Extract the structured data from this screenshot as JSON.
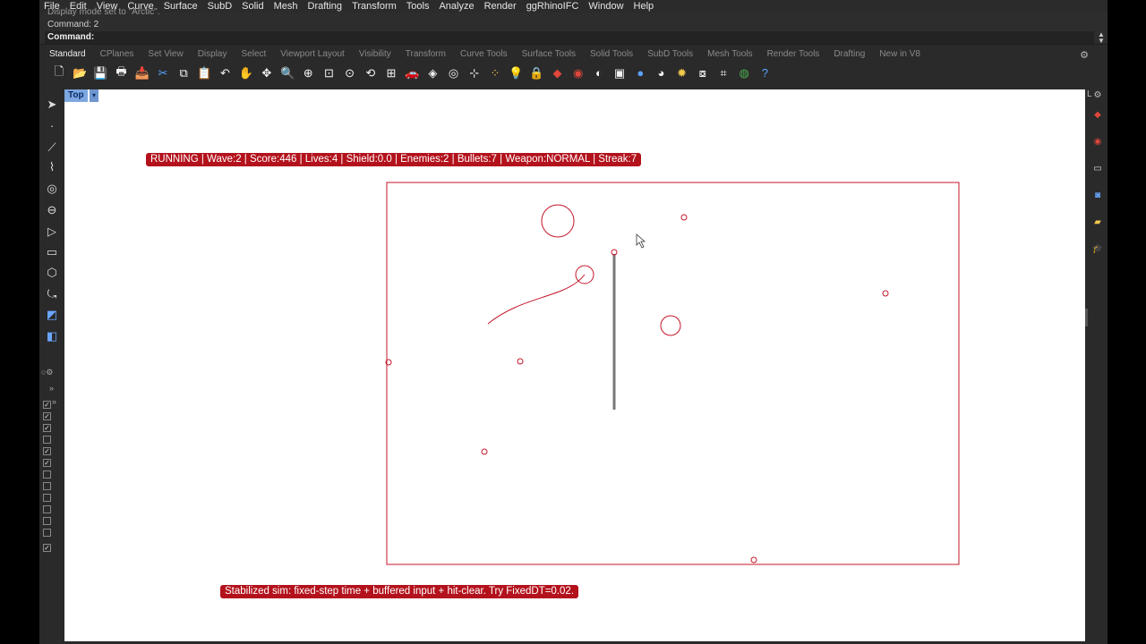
{
  "menu": [
    "File",
    "Edit",
    "View",
    "Curve",
    "Surface",
    "SubD",
    "Solid",
    "Mesh",
    "Drafting",
    "Transform",
    "Tools",
    "Analyze",
    "Render",
    "ggRhinoIFC",
    "Window",
    "Help"
  ],
  "command": {
    "history_0": "Display mode set to \"Arctic\".",
    "history_1": "Command: 2",
    "prompt_label": "Command:",
    "input_value": ""
  },
  "tabs": [
    "Standard",
    "CPlanes",
    "Set View",
    "Display",
    "Select",
    "Viewport Layout",
    "Visibility",
    "Transform",
    "Curve Tools",
    "Surface Tools",
    "Solid Tools",
    "SubD Tools",
    "Mesh Tools",
    "Render Tools",
    "Drafting",
    "New in V8"
  ],
  "active_tab": "Standard",
  "toolbar_icons": [
    {
      "name": "new-icon",
      "glyph": "🗋",
      "cls": "c1"
    },
    {
      "name": "open-icon",
      "glyph": "📂",
      "cls": "c2"
    },
    {
      "name": "save-icon",
      "glyph": "💾",
      "cls": "c1"
    },
    {
      "name": "print-icon",
      "glyph": "🖶",
      "cls": "c1"
    },
    {
      "name": "import-icon",
      "glyph": "📥",
      "cls": "c1"
    },
    {
      "name": "cut-icon",
      "glyph": "✂",
      "cls": "c3"
    },
    {
      "name": "copy-icon",
      "glyph": "⧉",
      "cls": "c1"
    },
    {
      "name": "paste-icon",
      "glyph": "📋",
      "cls": "c2"
    },
    {
      "name": "undo-icon",
      "glyph": "↶",
      "cls": "c1"
    },
    {
      "name": "pan-icon",
      "glyph": "✋",
      "cls": "c1"
    },
    {
      "name": "rotate-view-icon",
      "glyph": "✥",
      "cls": "c1"
    },
    {
      "name": "zoom-icon",
      "glyph": "🔍",
      "cls": "c1"
    },
    {
      "name": "zoom-window-icon",
      "glyph": "⊕",
      "cls": "c1"
    },
    {
      "name": "zoom-extents-icon",
      "glyph": "⊡",
      "cls": "c1"
    },
    {
      "name": "zoom-selected-icon",
      "glyph": "⊙",
      "cls": "c1"
    },
    {
      "name": "undo-view-icon",
      "glyph": "⟲",
      "cls": "c1"
    },
    {
      "name": "four-viewports-icon",
      "glyph": "⊞",
      "cls": "c1"
    },
    {
      "name": "car-icon",
      "glyph": "🚗",
      "cls": "c4"
    },
    {
      "name": "shaded-icon",
      "glyph": "◈",
      "cls": "c1"
    },
    {
      "name": "target-icon",
      "glyph": "◎",
      "cls": "c1"
    },
    {
      "name": "osnap-icon",
      "glyph": "⊹",
      "cls": "c1"
    },
    {
      "name": "select-points-icon",
      "glyph": "⁘",
      "cls": "c2"
    },
    {
      "name": "light-icon",
      "glyph": "💡",
      "cls": "c1"
    },
    {
      "name": "lock-icon",
      "glyph": "🔒",
      "cls": "c1"
    },
    {
      "name": "layer-icon",
      "glyph": "◆",
      "cls": "c4"
    },
    {
      "name": "color-wheel-icon",
      "glyph": "◉",
      "cls": "c4"
    },
    {
      "name": "sphere-icon",
      "glyph": "◐",
      "cls": "c1"
    },
    {
      "name": "render-window-icon",
      "glyph": "▣",
      "cls": "c1"
    },
    {
      "name": "render-icon",
      "glyph": "●",
      "cls": "c3"
    },
    {
      "name": "material-icon",
      "glyph": "◕",
      "cls": "c1"
    },
    {
      "name": "sun-icon",
      "glyph": "✹",
      "cls": "c2"
    },
    {
      "name": "layout-icon",
      "glyph": "⧇",
      "cls": "c1"
    },
    {
      "name": "dimension-icon",
      "glyph": "⌗",
      "cls": "c1"
    },
    {
      "name": "globe-icon",
      "glyph": "◍",
      "cls": "c5"
    },
    {
      "name": "help-icon",
      "glyph": "?",
      "cls": "c3"
    }
  ],
  "viewport": {
    "name": "Top",
    "hud_top": "RUNNING | Wave:2 | Score:446 | Lives:4 | Shield:0.0 | Enemies:2 | Bullets:7 | Weapon:NORMAL | Streak:7",
    "hud_bottom": "Stabilized sim: fixed-step time + buffered input + hit-clear. Try FixedDT=0.02."
  },
  "game": {
    "wave": 2,
    "score": 446,
    "lives": 4,
    "shield": 0.0,
    "enemies": 2,
    "bullets": 7,
    "weapon": "NORMAL",
    "streak": 7
  },
  "colors": {
    "accent_red": "#b3121c",
    "game_red": "#c4162a",
    "viewport_tab": "#7da7e0"
  }
}
